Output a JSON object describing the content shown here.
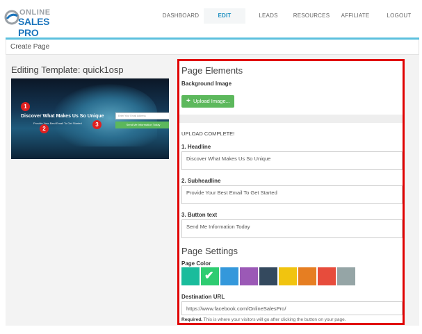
{
  "logo": {
    "line1": "ONLINE",
    "line2": "SALES PRO"
  },
  "nav": [
    "DASHBOARD",
    "EDIT",
    "LEADS",
    "RESOURCES",
    "AFFILIATE",
    "LOGOUT"
  ],
  "panel_title": "Create Page",
  "editing_title": "Editing Template: quick1osp",
  "preview": {
    "headline": "Discover What Makes Us So Unique",
    "subheadline": "Provide Your Best Email To Get Started",
    "input_placeholder": "Enter Your Email Address",
    "button": "Send Me Information Today",
    "badges": [
      "1",
      "2",
      "3"
    ]
  },
  "elements": {
    "title": "Page Elements",
    "bg_label": "Background Image",
    "upload_label": "Upload Image...",
    "upload_status": "UPLOAD COMPLETE!",
    "headline_label": "1. Headline",
    "headline_value": "Discover What Makes Us So Unique",
    "subheadline_label": "2. Subheadline",
    "subheadline_value": "Provide Your Best Email To Get Started",
    "button_label": "3. Button text",
    "button_value": "Send Me Information Today"
  },
  "settings": {
    "title": "Page Settings",
    "color_label": "Page Color",
    "colors": [
      "#1abc9c",
      "#2ecc71",
      "#3498db",
      "#9b59b6",
      "#34495e",
      "#f1c40f",
      "#e67e22",
      "#e74c3c",
      "#95a5a6"
    ],
    "selected_color_index": 1,
    "url_label": "Destination URL",
    "url_value": "https://www.facebook.com/OnlineSalesPro/",
    "help_bold": "Required.",
    "help_text": " This is where your visitors will go after clicking the button on your page."
  }
}
